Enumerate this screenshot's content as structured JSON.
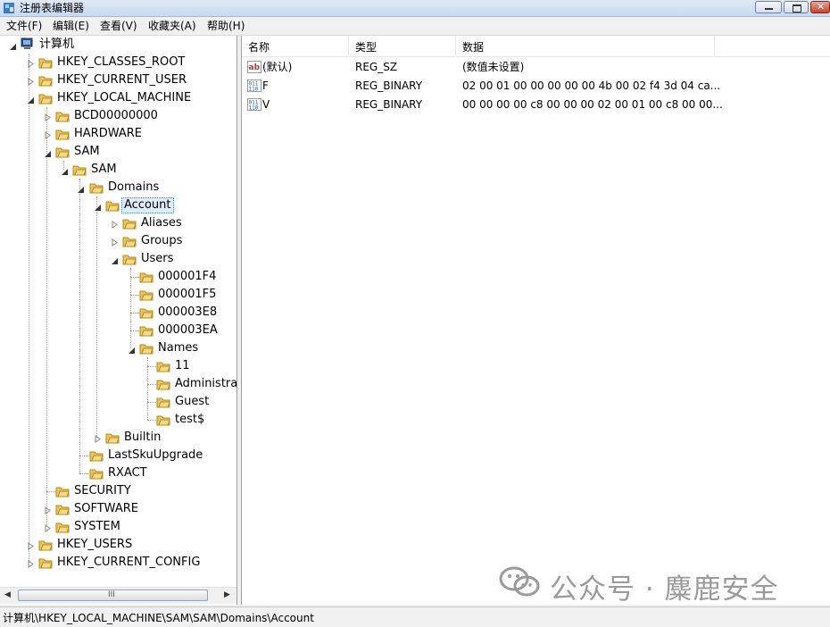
{
  "window": {
    "title": "注册表编辑器"
  },
  "menu": [
    "文件(F)",
    "编辑(E)",
    "查看(V)",
    "收藏夹(A)",
    "帮助(H)"
  ],
  "tree": {
    "root": "计算机",
    "hkcr": "HKEY_CLASSES_ROOT",
    "hkcu": "HKEY_CURRENT_USER",
    "hklm": "HKEY_LOCAL_MACHINE",
    "bcd": "BCD00000000",
    "hardware": "HARDWARE",
    "sam": "SAM",
    "sam2": "SAM",
    "domains": "Domains",
    "account": "Account",
    "aliases": "Aliases",
    "groups": "Groups",
    "users": "Users",
    "u1f4": "000001F4",
    "u1f5": "000001F5",
    "u3e8": "000003E8",
    "u3ea": "000003EA",
    "names": "Names",
    "n11": "11",
    "nadmin": "Administrat",
    "nguest": "Guest",
    "ntest": "test$",
    "builtin": "Builtin",
    "lastsku": "LastSkuUpgrade",
    "rxact": "RXACT",
    "security": "SECURITY",
    "software": "SOFTWARE",
    "system": "SYSTEM",
    "hku": "HKEY_USERS",
    "hkcc": "HKEY_CURRENT_CONFIG"
  },
  "list": {
    "headers": {
      "name": "名称",
      "type": "类型",
      "data": "数据"
    },
    "rows": [
      {
        "icon": "string-value-icon",
        "name": "(默认)",
        "type": "REG_SZ",
        "data": "(数值未设置)"
      },
      {
        "icon": "binary-value-icon",
        "name": "F",
        "type": "REG_BINARY",
        "data": "02 00 01 00 00 00 00 00 4b 00 02 f4 3d 04 ca..."
      },
      {
        "icon": "binary-value-icon",
        "name": "V",
        "type": "REG_BINARY",
        "data": "00 00 00 00 c8 00 00 00 02 00 01 00 c8 00 00..."
      }
    ]
  },
  "status": "计算机\\HKEY_LOCAL_MACHINE\\SAM\\SAM\\Domains\\Account",
  "watermark": "公众号 · 麋鹿安全",
  "scrollbar": {
    "grip": "III"
  },
  "colors": {
    "folder": "#e9c45a",
    "selection": "#dfedfb",
    "titlebar": "#c9d9ee"
  }
}
